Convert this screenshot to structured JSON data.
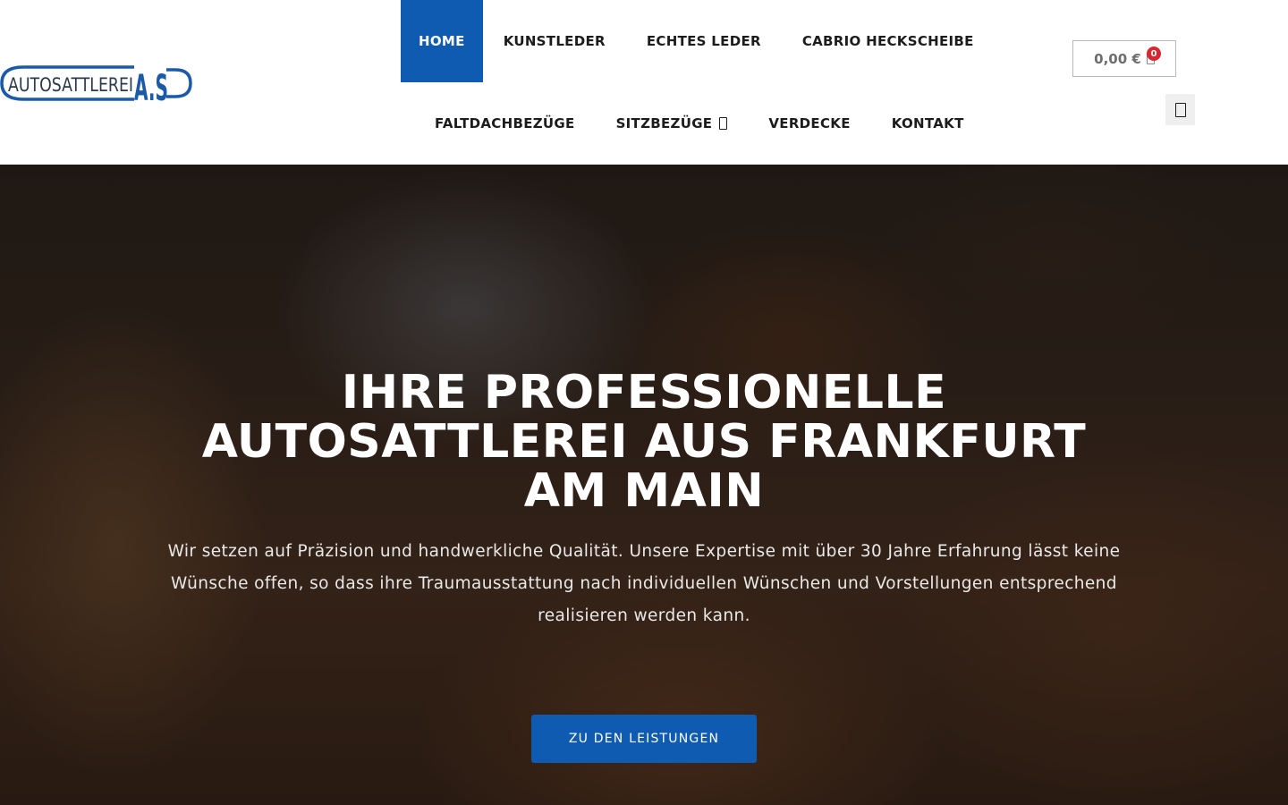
{
  "logo": {
    "text": "AUTOSATTLEREI",
    "mark": "A.S"
  },
  "nav": {
    "row1": [
      {
        "label": "HOME",
        "active": true
      },
      {
        "label": "KUNSTLEDER"
      },
      {
        "label": "ECHTES LEDER"
      },
      {
        "label": "CABRIO HECKSCHEIBE"
      }
    ],
    "row2": [
      {
        "label": "FALTDACHBEZÜGE"
      },
      {
        "label": "SITZBEZÜGE",
        "icon": "chevron-down-icon"
      },
      {
        "label": "VERDECKE"
      },
      {
        "label": "KONTAKT"
      }
    ]
  },
  "cart": {
    "amount": "0,00 €",
    "count": "0",
    "icon": "cart-icon"
  },
  "search": {
    "icon": "search-icon"
  },
  "hero": {
    "title": "IHRE PROFESSIONELLE AUTOSATTLEREI AUS FRANKFURT AM MAIN",
    "text": "Wir setzen auf Präzision und handwerkliche Qualität. Unsere Expertise mit über 30 Jahre Erfahrung lässt keine Wünsche offen, so dass ihre Traumausstattung nach individuellen Wünschen und Vorstellungen entsprechend realisieren werden kann.",
    "button": "ZU DEN LEISTUNGEN"
  },
  "colors": {
    "accent": "#0e5bb1",
    "badge": "#d9262f",
    "text": "#1c1c1c"
  }
}
